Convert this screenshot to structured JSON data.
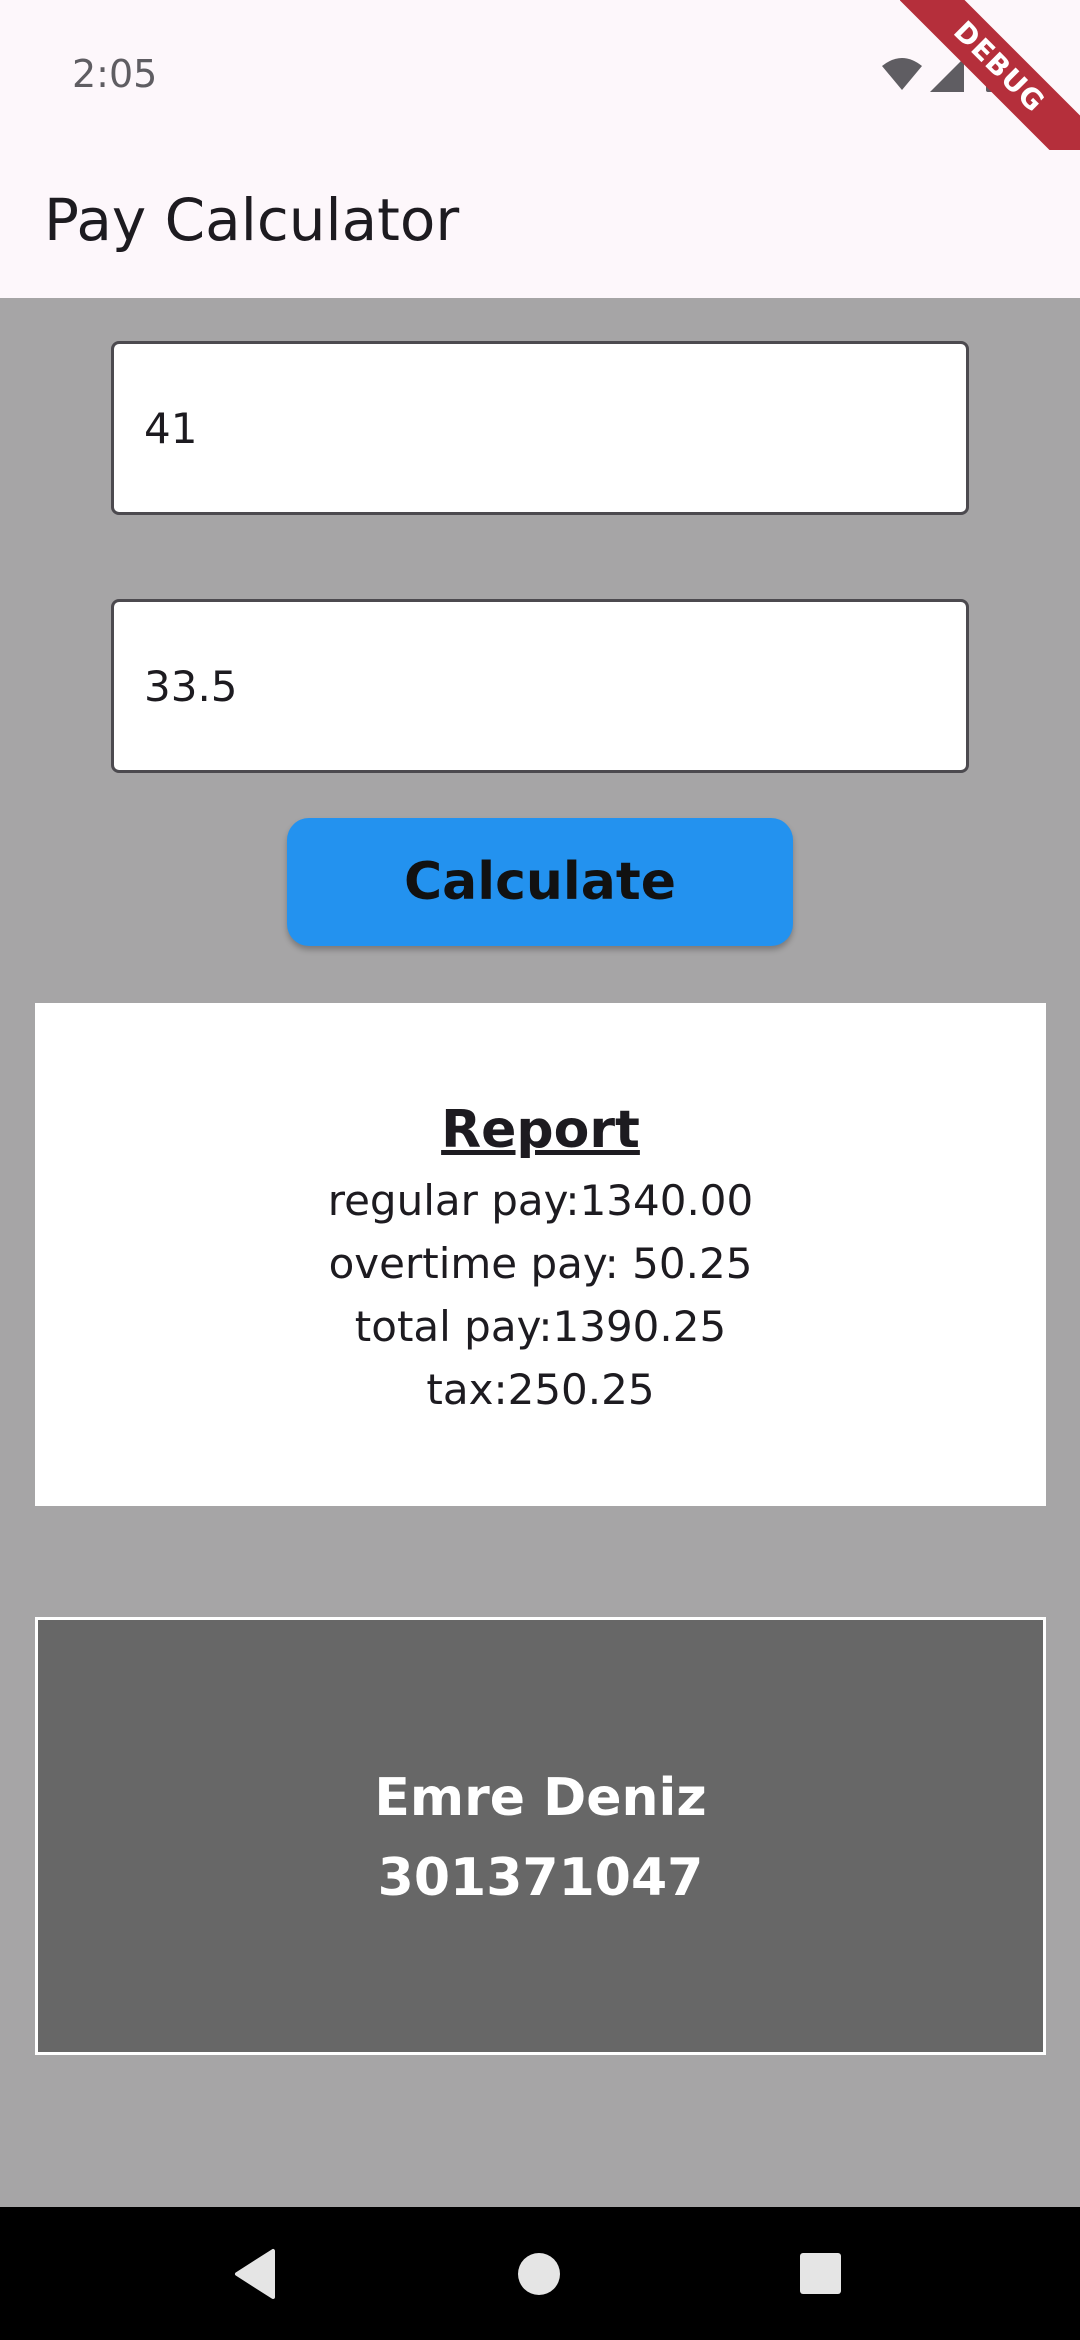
{
  "status_bar": {
    "time": "2:05",
    "icons": [
      "wifi-icon",
      "signal-icon",
      "battery-icon"
    ]
  },
  "debug_banner": {
    "label": "DEBUG"
  },
  "app_bar": {
    "title": "Pay Calculator"
  },
  "form": {
    "hours_value": "41",
    "rate_value": "33.5",
    "calculate_label": "Calculate"
  },
  "report": {
    "title": "Report",
    "regular_pay": "regular pay:1340.00",
    "overtime_pay": "overtime pay: 50.25",
    "total_pay": "total pay:1390.25",
    "tax": "tax:250.25"
  },
  "student": {
    "name": "Emre Deniz",
    "id": "301371047"
  },
  "nav_bar": {
    "icons": [
      "back-icon",
      "home-icon",
      "recents-icon"
    ]
  },
  "colors": {
    "background": "#a6a5a6",
    "app_bar": "#fdf7fb",
    "button": "#2392ef",
    "name_card": "#676767",
    "debug_ribbon": "#b52f3b"
  }
}
